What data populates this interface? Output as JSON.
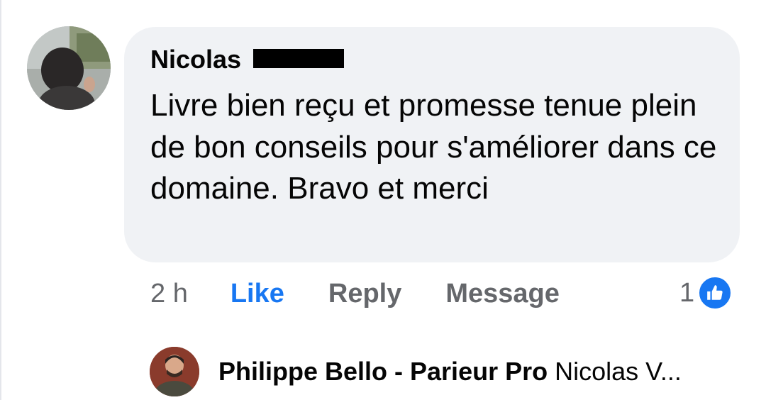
{
  "comment": {
    "author": "Nicolas",
    "text": "Livre bien reçu et promesse tenue plein de bon conseils pour s'améliorer dans ce domaine. Bravo et merci",
    "timestamp": "2 h",
    "actions": {
      "like": "Like",
      "reply": "Reply",
      "message": "Message"
    },
    "reaction_count": "1",
    "reaction_icon": "thumbs-up-icon"
  },
  "reply": {
    "author": "Philippe Bello - Parieur Pro",
    "preview": "Nicolas V..."
  },
  "colors": {
    "bubble": "#f0f2f5",
    "like_blue": "#1877f2",
    "secondary_text": "#65676b",
    "primary_text": "#050505"
  }
}
